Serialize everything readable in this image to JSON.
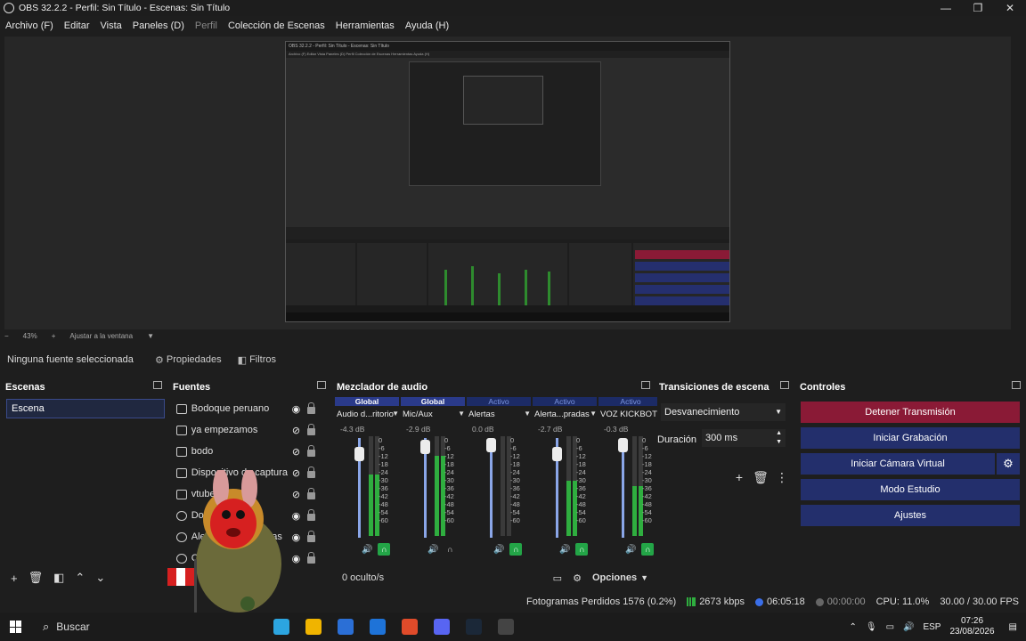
{
  "window": {
    "title": "OBS 32.2.2 - Perfil: Sin Título - Escenas: Sin Título",
    "controls": [
      "—",
      "❐",
      "✕"
    ]
  },
  "menu": [
    "Archivo (F)",
    "Editar",
    "Vista",
    "Paneles (D)",
    "Perfil",
    "Colección de Escenas",
    "Herramientas",
    "Ayuda (H)"
  ],
  "preview": {
    "nested_title": "OBS 32.2.2 - Perfil: Sin Título - Escenas: Sin Título",
    "nested_menu": "Archivo (F)   Editar   Vista   Paneles (D)   Perfil   Colección de Escenas   Herramientas   Ayuda (H)",
    "zoom": "43%",
    "fit_label": "Ajustar a la ventana"
  },
  "source_toolbar": {
    "no_source": "Ninguna fuente seleccionada",
    "properties": "Propiedades",
    "filters": "Filtros"
  },
  "scenes": {
    "title": "Escenas",
    "items": [
      "Escena"
    ]
  },
  "sources": {
    "title": "Fuentes",
    "items": [
      {
        "name": "Bodoque peruano",
        "visible": true
      },
      {
        "name": "ya empezamos",
        "visible": false
      },
      {
        "name": "bodo",
        "visible": false
      },
      {
        "name": "Dispositivo de captura",
        "visible": false
      },
      {
        "name": "vtuber",
        "visible": false
      },
      {
        "name": "Donaciones",
        "visible": true
      },
      {
        "name": "Alertas programadas",
        "visible": true
      },
      {
        "name": "Chat",
        "visible": true
      }
    ]
  },
  "mixer": {
    "title": "Mezclador de audio",
    "channels": [
      {
        "tag": "Global",
        "name": "Audio d...ritorio",
        "db": "-4.3 dB",
        "level": 0.62,
        "knob": 0.1,
        "monitor": true
      },
      {
        "tag": "Global",
        "name": "Mic/Aux",
        "db": "-2.9 dB",
        "level": 0.8,
        "knob": 0.02,
        "monitor": false
      },
      {
        "tag": "Activo",
        "name": "Alertas",
        "db": "0.0 dB",
        "level": 0.0,
        "knob": 0.0,
        "monitor": true
      },
      {
        "tag": "Activo",
        "name": "Alerta...pradas",
        "db": "-2.7 dB",
        "level": 0.55,
        "knob": 0.1,
        "monitor": true
      },
      {
        "tag": "Activo",
        "name": "VOZ KICKBOT",
        "db": "-0.3 dB",
        "level": 0.5,
        "knob": 0.0,
        "monitor": true
      }
    ],
    "scale": [
      "0",
      "-6",
      "-12",
      "-18",
      "-24",
      "-30",
      "-36",
      "-42",
      "-48",
      "-54",
      "-60"
    ],
    "hidden": "0 oculto/s",
    "options": "Opciones"
  },
  "transitions": {
    "title": "Transiciones de escena",
    "type": "Desvanecimiento",
    "duration_label": "Duración",
    "duration": "300 ms"
  },
  "controls": {
    "title": "Controles",
    "stop_stream": "Detener Transmisión",
    "start_record": "Iniciar Grabación",
    "start_virtual_cam": "Iniciar Cámara Virtual",
    "studio_mode": "Modo Estudio",
    "settings": "Ajustes"
  },
  "status": {
    "dropped": "Fotogramas Perdidos 1576 (0.2%)",
    "bitrate": "2673 kbps",
    "stream_time": "06:05:18",
    "rec_time": "00:00:00",
    "cpu": "CPU: 11.0%",
    "fps": "30.00 / 30.00 FPS"
  },
  "taskbar": {
    "search": "Buscar",
    "lang": "ESP",
    "time": "07:26",
    "date": "23/08/2026",
    "apps": [
      "#2ca5e0",
      "#f0b400",
      "#2b6fd6",
      "#1e73d8",
      "#e04b2a",
      "#5865f2",
      "#1b2838",
      "#444444"
    ]
  },
  "colors": {
    "stop_button": "#8a1a36",
    "control_button": "#232f6c",
    "meter": "#2fae3f",
    "accent": "#2a3a8a"
  }
}
